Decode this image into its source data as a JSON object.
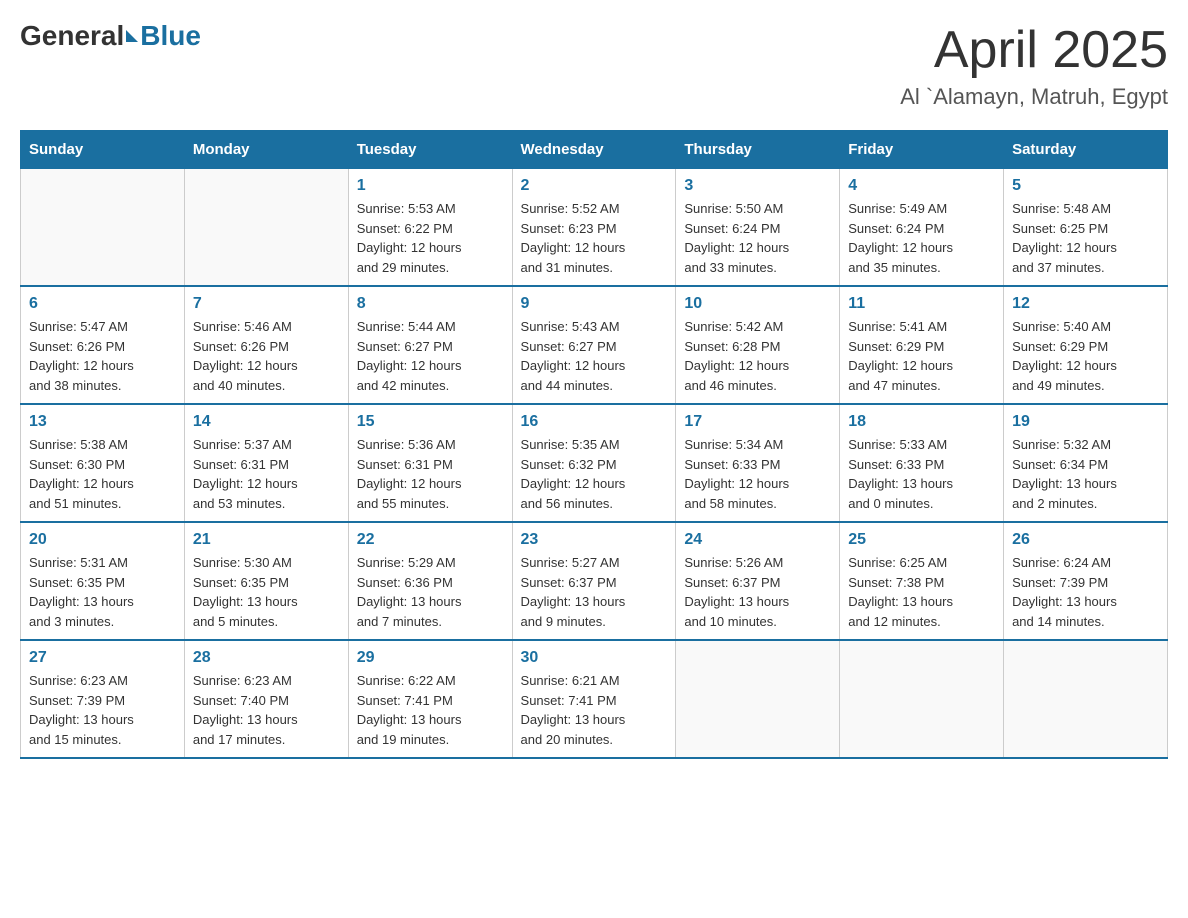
{
  "header": {
    "logo_general": "General",
    "logo_blue": "Blue",
    "month_year": "April 2025",
    "location": "Al `Alamayn, Matruh, Egypt"
  },
  "days_of_week": [
    "Sunday",
    "Monday",
    "Tuesday",
    "Wednesday",
    "Thursday",
    "Friday",
    "Saturday"
  ],
  "weeks": [
    [
      {
        "day": "",
        "info": ""
      },
      {
        "day": "",
        "info": ""
      },
      {
        "day": "1",
        "info": "Sunrise: 5:53 AM\nSunset: 6:22 PM\nDaylight: 12 hours\nand 29 minutes."
      },
      {
        "day": "2",
        "info": "Sunrise: 5:52 AM\nSunset: 6:23 PM\nDaylight: 12 hours\nand 31 minutes."
      },
      {
        "day": "3",
        "info": "Sunrise: 5:50 AM\nSunset: 6:24 PM\nDaylight: 12 hours\nand 33 minutes."
      },
      {
        "day": "4",
        "info": "Sunrise: 5:49 AM\nSunset: 6:24 PM\nDaylight: 12 hours\nand 35 minutes."
      },
      {
        "day": "5",
        "info": "Sunrise: 5:48 AM\nSunset: 6:25 PM\nDaylight: 12 hours\nand 37 minutes."
      }
    ],
    [
      {
        "day": "6",
        "info": "Sunrise: 5:47 AM\nSunset: 6:26 PM\nDaylight: 12 hours\nand 38 minutes."
      },
      {
        "day": "7",
        "info": "Sunrise: 5:46 AM\nSunset: 6:26 PM\nDaylight: 12 hours\nand 40 minutes."
      },
      {
        "day": "8",
        "info": "Sunrise: 5:44 AM\nSunset: 6:27 PM\nDaylight: 12 hours\nand 42 minutes."
      },
      {
        "day": "9",
        "info": "Sunrise: 5:43 AM\nSunset: 6:27 PM\nDaylight: 12 hours\nand 44 minutes."
      },
      {
        "day": "10",
        "info": "Sunrise: 5:42 AM\nSunset: 6:28 PM\nDaylight: 12 hours\nand 46 minutes."
      },
      {
        "day": "11",
        "info": "Sunrise: 5:41 AM\nSunset: 6:29 PM\nDaylight: 12 hours\nand 47 minutes."
      },
      {
        "day": "12",
        "info": "Sunrise: 5:40 AM\nSunset: 6:29 PM\nDaylight: 12 hours\nand 49 minutes."
      }
    ],
    [
      {
        "day": "13",
        "info": "Sunrise: 5:38 AM\nSunset: 6:30 PM\nDaylight: 12 hours\nand 51 minutes."
      },
      {
        "day": "14",
        "info": "Sunrise: 5:37 AM\nSunset: 6:31 PM\nDaylight: 12 hours\nand 53 minutes."
      },
      {
        "day": "15",
        "info": "Sunrise: 5:36 AM\nSunset: 6:31 PM\nDaylight: 12 hours\nand 55 minutes."
      },
      {
        "day": "16",
        "info": "Sunrise: 5:35 AM\nSunset: 6:32 PM\nDaylight: 12 hours\nand 56 minutes."
      },
      {
        "day": "17",
        "info": "Sunrise: 5:34 AM\nSunset: 6:33 PM\nDaylight: 12 hours\nand 58 minutes."
      },
      {
        "day": "18",
        "info": "Sunrise: 5:33 AM\nSunset: 6:33 PM\nDaylight: 13 hours\nand 0 minutes."
      },
      {
        "day": "19",
        "info": "Sunrise: 5:32 AM\nSunset: 6:34 PM\nDaylight: 13 hours\nand 2 minutes."
      }
    ],
    [
      {
        "day": "20",
        "info": "Sunrise: 5:31 AM\nSunset: 6:35 PM\nDaylight: 13 hours\nand 3 minutes."
      },
      {
        "day": "21",
        "info": "Sunrise: 5:30 AM\nSunset: 6:35 PM\nDaylight: 13 hours\nand 5 minutes."
      },
      {
        "day": "22",
        "info": "Sunrise: 5:29 AM\nSunset: 6:36 PM\nDaylight: 13 hours\nand 7 minutes."
      },
      {
        "day": "23",
        "info": "Sunrise: 5:27 AM\nSunset: 6:37 PM\nDaylight: 13 hours\nand 9 minutes."
      },
      {
        "day": "24",
        "info": "Sunrise: 5:26 AM\nSunset: 6:37 PM\nDaylight: 13 hours\nand 10 minutes."
      },
      {
        "day": "25",
        "info": "Sunrise: 6:25 AM\nSunset: 7:38 PM\nDaylight: 13 hours\nand 12 minutes."
      },
      {
        "day": "26",
        "info": "Sunrise: 6:24 AM\nSunset: 7:39 PM\nDaylight: 13 hours\nand 14 minutes."
      }
    ],
    [
      {
        "day": "27",
        "info": "Sunrise: 6:23 AM\nSunset: 7:39 PM\nDaylight: 13 hours\nand 15 minutes."
      },
      {
        "day": "28",
        "info": "Sunrise: 6:23 AM\nSunset: 7:40 PM\nDaylight: 13 hours\nand 17 minutes."
      },
      {
        "day": "29",
        "info": "Sunrise: 6:22 AM\nSunset: 7:41 PM\nDaylight: 13 hours\nand 19 minutes."
      },
      {
        "day": "30",
        "info": "Sunrise: 6:21 AM\nSunset: 7:41 PM\nDaylight: 13 hours\nand 20 minutes."
      },
      {
        "day": "",
        "info": ""
      },
      {
        "day": "",
        "info": ""
      },
      {
        "day": "",
        "info": ""
      }
    ]
  ]
}
